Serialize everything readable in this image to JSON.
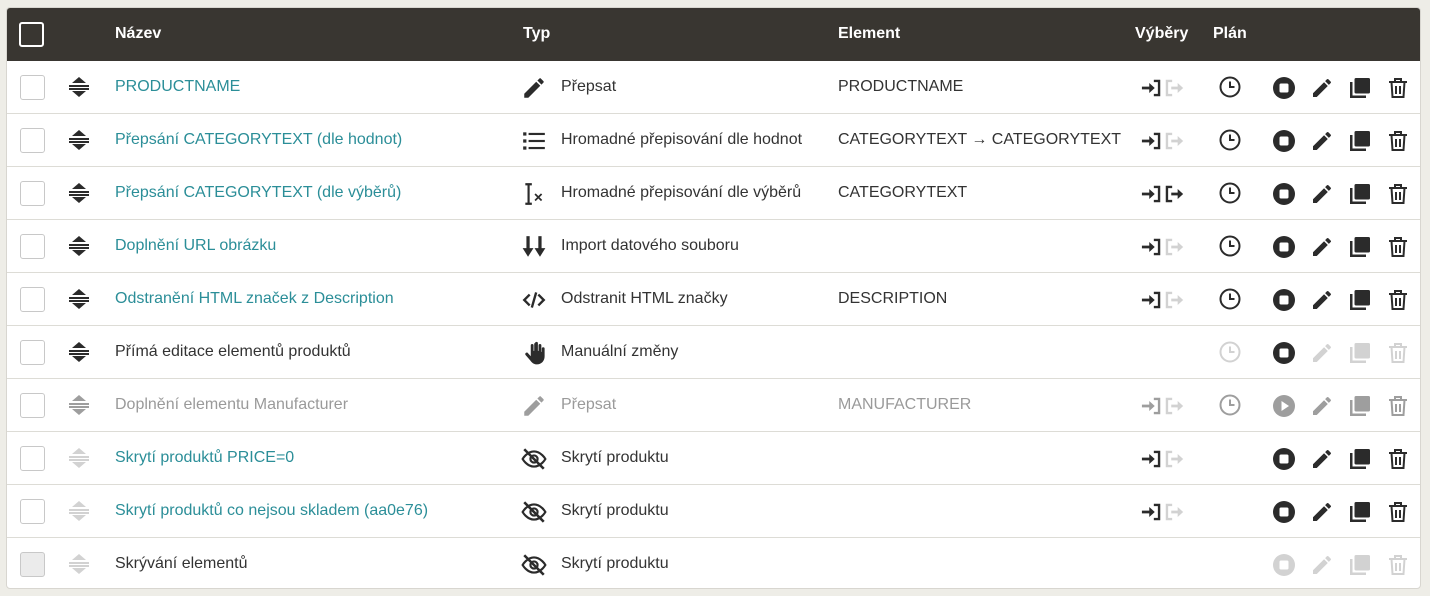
{
  "header": {
    "name": "Název",
    "type": "Typ",
    "element": "Element",
    "selections": "Výběry",
    "plan": "Plán"
  },
  "colors": {
    "header_bg": "#393631",
    "link": "#2b8e98",
    "icon": "#2b2b2b",
    "muted_icon": "#c4c4c4"
  },
  "rows": [
    {
      "name": "PRODUCTNAME",
      "type": "Přepsat",
      "type_icon": "pencil-icon",
      "element": "PRODUCTNAME"
    },
    {
      "name": "Přepsání CATEGORYTEXT (dle hodnot)",
      "type": "Hromadné přepisování dle hodnot",
      "type_icon": "list-icon",
      "element": "CATEGORYTEXT → CATEGORYTEXT"
    },
    {
      "name": "Přepsání CATEGORYTEXT (dle výběrů)",
      "type": "Hromadné přepisování dle výběrů",
      "type_icon": "text-cursor-x-icon",
      "element": "CATEGORYTEXT"
    },
    {
      "name": "Doplnění URL obrázku",
      "type": "Import datového souboru",
      "type_icon": "import-arrows-icon",
      "element": ""
    },
    {
      "name": "Odstranění HTML značek z Description",
      "type": "Odstranit HTML značky",
      "type_icon": "code-icon",
      "element": "DESCRIPTION"
    },
    {
      "name": "Přímá editace elementů produktů",
      "type": "Manuální změny",
      "type_icon": "hand-icon",
      "element": ""
    },
    {
      "name": "Doplnění elementu Manufacturer",
      "type": "Přepsat",
      "type_icon": "pencil-icon",
      "element": "MANUFACTURER"
    },
    {
      "name": "Skrytí produktů PRICE=0",
      "type": "Skrytí produktu",
      "type_icon": "eye-slash-icon",
      "element": ""
    },
    {
      "name": "Skrytí produktů co nejsou skladem (aa0e76)",
      "type": "Skrytí produktu",
      "type_icon": "eye-slash-icon",
      "element": ""
    },
    {
      "name": "Skrývání elementů",
      "type": "Skrytí produktu",
      "type_icon": "eye-slash-icon",
      "element": ""
    }
  ]
}
